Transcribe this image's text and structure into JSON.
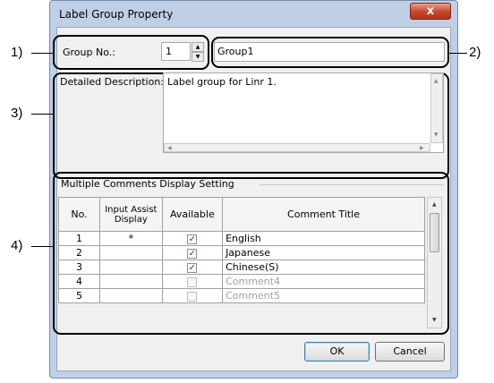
{
  "window": {
    "title": "Label Group Property",
    "close_glyph": "x"
  },
  "group": {
    "label": "Group No.:",
    "number": "1",
    "name": "Group1"
  },
  "description": {
    "label": "Detailed Description:",
    "text": "Label group for Linr 1."
  },
  "comments": {
    "section_title": "Multiple Comments Display Setting",
    "headers": {
      "no": "No.",
      "input_assist": "Input Assist Display",
      "available": "Available",
      "comment_title": "Comment Title"
    },
    "rows": [
      {
        "no": "1",
        "assist": "*",
        "available": true,
        "title": "English",
        "muted": false
      },
      {
        "no": "2",
        "assist": "",
        "available": true,
        "title": "Japanese",
        "muted": false
      },
      {
        "no": "3",
        "assist": "",
        "available": true,
        "title": "Chinese(S)",
        "muted": false
      },
      {
        "no": "4",
        "assist": "",
        "available": false,
        "title": "Comment4",
        "muted": true
      },
      {
        "no": "5",
        "assist": "",
        "available": false,
        "title": "Comment5",
        "muted": true
      }
    ]
  },
  "buttons": {
    "ok": "OK",
    "cancel": "Cancel"
  },
  "annotations": {
    "a1": "1)",
    "a2": "2)",
    "a3": "3)",
    "a4": "4)"
  },
  "icons": {
    "checkmark": "✓",
    "up": "▲",
    "down": "▼",
    "left": "◀",
    "right": "▶"
  }
}
